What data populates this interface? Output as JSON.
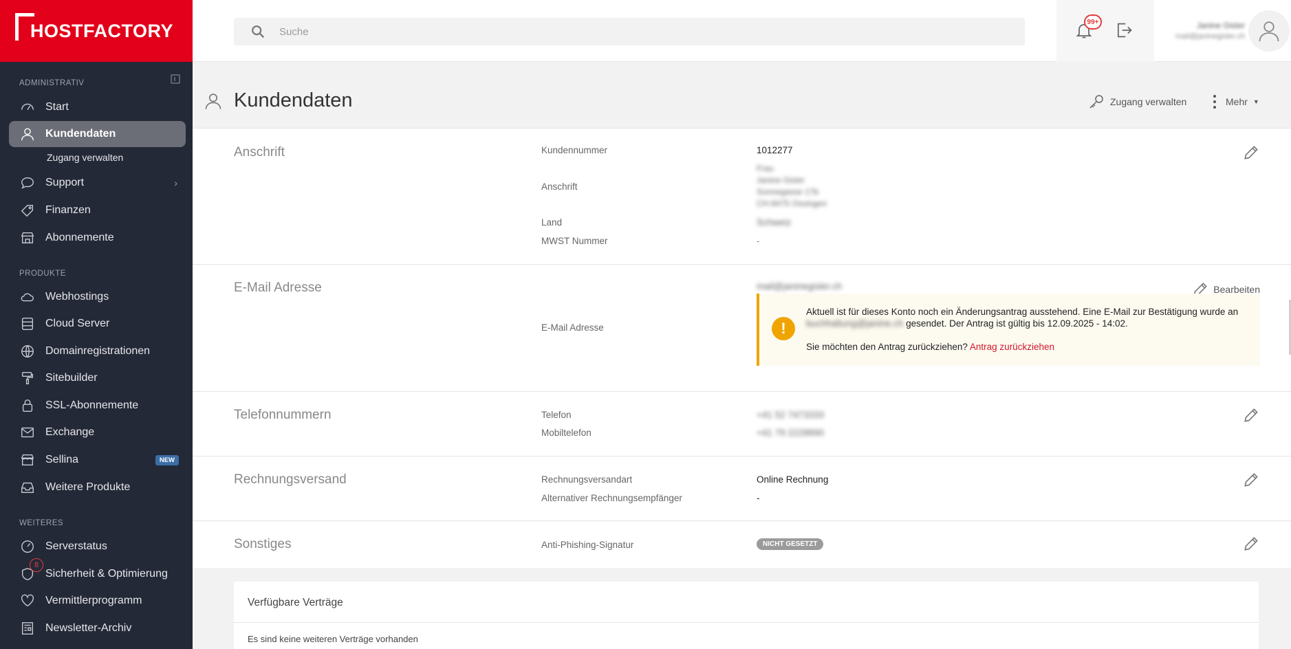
{
  "brand": {
    "logo_text": "HOSTFACTORY"
  },
  "sidebar": {
    "sections": [
      {
        "title": "ADMINISTRATIV"
      },
      {
        "title": "PRODUKTE"
      },
      {
        "title": "WEITERES"
      }
    ],
    "items": [
      {
        "label": "Start",
        "icon": "gauge-icon"
      },
      {
        "label": "Kundendaten",
        "icon": "user-icon"
      },
      {
        "label": "Zugang verwalten"
      },
      {
        "label": "Support",
        "icon": "chat-icon",
        "chevron": "›"
      },
      {
        "label": "Finanzen",
        "icon": "tag-icon"
      },
      {
        "label": "Abonnemente",
        "icon": "store-icon"
      },
      {
        "label": "Webhostings",
        "icon": "cloud-icon"
      },
      {
        "label": "Cloud Server",
        "icon": "server-icon"
      },
      {
        "label": "Domainregistrationen",
        "icon": "globe-icon"
      },
      {
        "label": "Sitebuilder",
        "icon": "paint-roller-icon"
      },
      {
        "label": "SSL-Abonnemente",
        "icon": "lock-icon"
      },
      {
        "label": "Exchange",
        "icon": "mail-icon"
      },
      {
        "label": "Sellina",
        "icon": "shop-icon",
        "badge": "NEW"
      },
      {
        "label": "Weitere Produkte",
        "icon": "inbox-icon"
      },
      {
        "label": "Serverstatus",
        "icon": "gauge-icon"
      },
      {
        "label": "Sicherheit & Optimierung",
        "icon": "shield-icon",
        "count": "8"
      },
      {
        "label": "Vermittlerprogramm",
        "icon": "heart-icon"
      },
      {
        "label": "Newsletter-Archiv",
        "icon": "newspaper-icon"
      }
    ]
  },
  "topbar": {
    "search_placeholder": "Suche",
    "notification_count": "99+",
    "user_name": "Janine Gisler",
    "user_email": "mail@janinegisler.ch"
  },
  "page": {
    "title": "Kundendaten",
    "actions": {
      "access": "Zugang verwalten",
      "more": "Mehr"
    }
  },
  "sections": {
    "anschrift": {
      "title": "Anschrift",
      "labels": {
        "customer_no": "Kundennummer",
        "address": "Anschrift",
        "country": "Land",
        "vat": "MWST Nummer"
      },
      "values": {
        "customer_no": "1012277",
        "address_lines": [
          "Frau",
          "Janine Gisler",
          "Sonnegasse 17b",
          "CH-8475 Ossingen"
        ],
        "country": "Schweiz",
        "vat": "-"
      }
    },
    "email": {
      "title": "E-Mail Adresse",
      "label": "E-Mail Adresse",
      "value": "mail@janinegisler.ch",
      "edit_label": "Bearbeiten",
      "notice": {
        "line1": "Aktuell ist für dieses Konto noch ein Änderungsantrag ausstehend. Eine E-Mail zur Bestätigung wurde an",
        "pending_email": "buchhaltung@janine.ch",
        "line2": " gesendet. Der Antrag ist gültig bis 12.09.2025 - 14:02.",
        "question": "Sie möchten den Antrag zurückziehen? ",
        "link": "Antrag zurückziehen"
      }
    },
    "phone": {
      "title": "Telefonnummern",
      "labels": {
        "phone": "Telefon",
        "mobile": "Mobiltelefon"
      },
      "values": {
        "phone": "+41 52 7473333",
        "mobile": "+41 79 2228890"
      }
    },
    "billing": {
      "title": "Rechnungsversand",
      "labels": {
        "type": "Rechnungsversandart",
        "alt": "Alternativer Rechnungsempfänger"
      },
      "values": {
        "type": "Online Rechnung",
        "alt": "-"
      }
    },
    "other": {
      "title": "Sonstiges",
      "label": "Anti-Phishing-Signatur",
      "value": "NICHT GESETZT"
    }
  },
  "contracts": {
    "title": "Verfügbare Verträge",
    "empty": "Es sind keine weiteren Verträge vorhanden"
  }
}
